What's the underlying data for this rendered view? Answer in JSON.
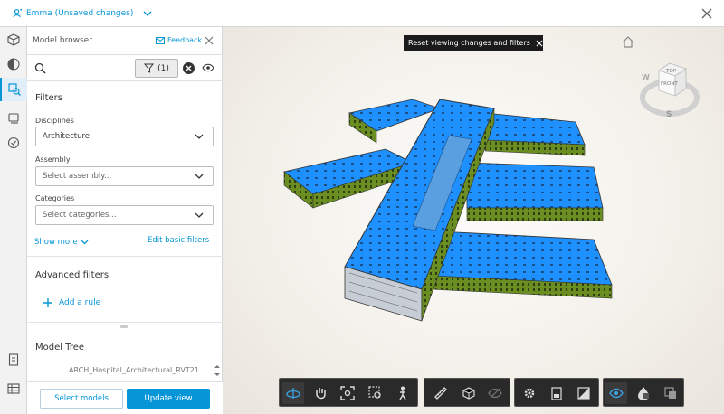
{
  "header": {
    "view_name": "Emma (Unsaved changes)"
  },
  "panel": {
    "title": "Model browser",
    "feedback": "Feedback",
    "filter_count": "(1)",
    "filters_heading": "Filters",
    "disciplines_label": "Disciplines",
    "disciplines_value": "Architecture",
    "assembly_label": "Assembly",
    "assembly_placeholder": "Select assembly...",
    "categories_label": "Categories",
    "categories_placeholder": "Select categories...",
    "show_more": "Show more",
    "edit_basic": "Edit basic filters",
    "advanced_heading": "Advanced filters",
    "add_rule": "Add a rule",
    "model_tree_heading": "Model Tree",
    "tree_item": "ARCH_Hospital_Architectural_RVT21...",
    "select_models": "Select models",
    "update_view": "Update view"
  },
  "viewer": {
    "reset_banner": "Reset viewing changes and filters",
    "cube_top": "TOP",
    "cube_front": "FRONT",
    "compass_w": "W",
    "compass_s": "S"
  },
  "toolbar": {
    "groups": [
      [
        "orbit-icon",
        "pan-icon",
        "zoom-fit-icon",
        "zoom-window-icon",
        "first-person-icon"
      ],
      [
        "measure-icon",
        "section-box-icon",
        "hide-objects-icon"
      ],
      [
        "settings-icon",
        "sheets-icon",
        "fullscreen-icon"
      ],
      [
        "visibility-icon",
        "properties-icon",
        "layers-icon"
      ]
    ]
  },
  "colors": {
    "accent": "#0696d7",
    "building_green": "#6b8e23",
    "building_blue": "#1e90ff"
  }
}
